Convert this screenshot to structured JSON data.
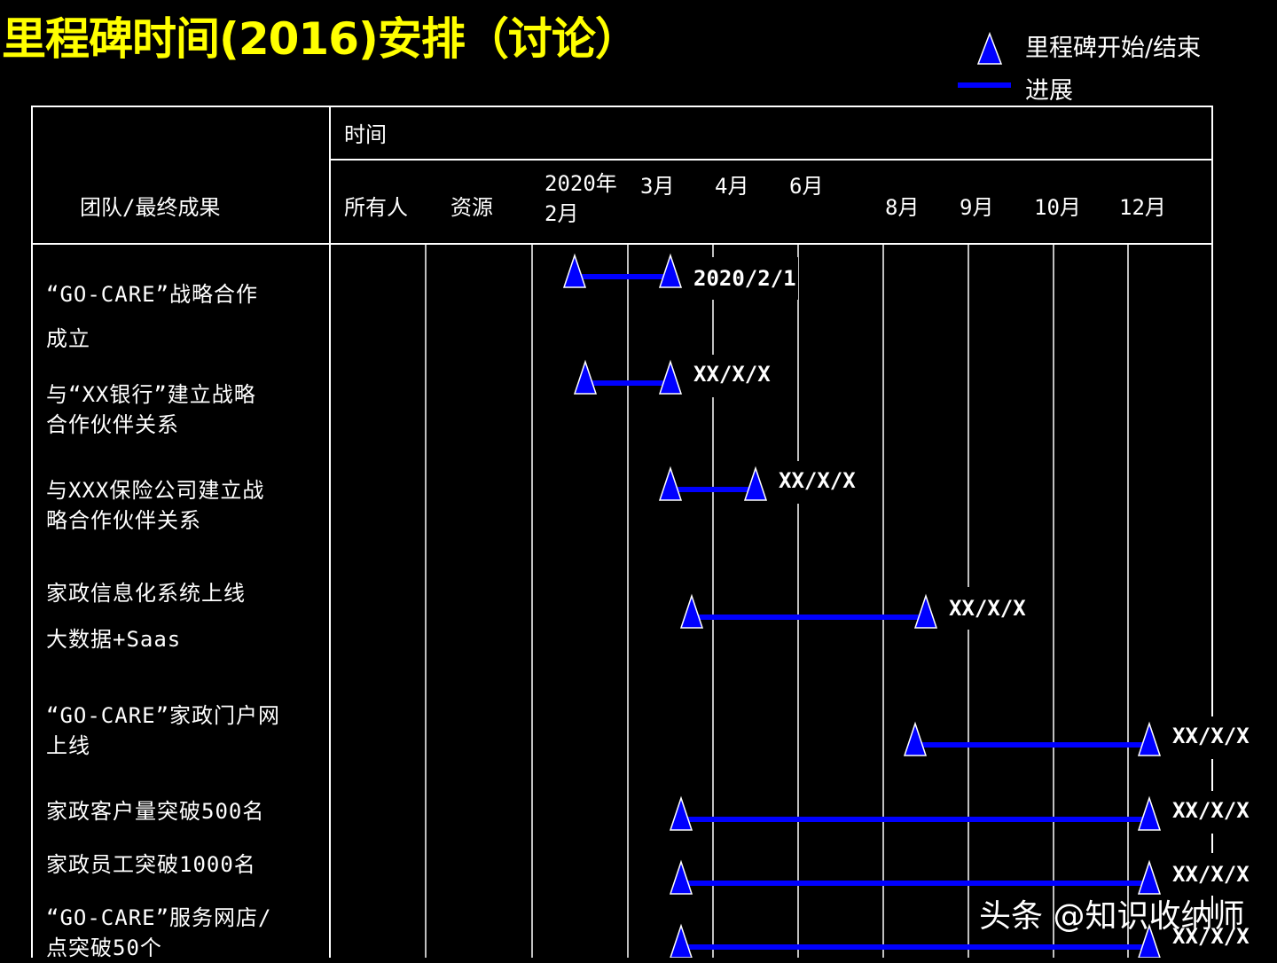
{
  "title": "里程碑时间(2016)安排（讨论）",
  "legend": {
    "milestone_label": "里程碑开始/结束",
    "progress_label": "进展"
  },
  "header": {
    "team_label": "团队/最终成果",
    "time_label": "时间",
    "owner_label": "所有人",
    "resource_label": "资源",
    "months": [
      "2020年\n2月",
      "3月",
      "4月",
      "6月",
      "8月",
      "9月",
      "10月",
      "12月"
    ]
  },
  "tasks": [
    {
      "label": "“GO-CARE”战略合作\n\n成立",
      "end_label": "2020/2/1"
    },
    {
      "label": "与“XX银行”建立战略\n合作伙伴关系",
      "end_label": "XX/X/X"
    },
    {
      "label": "与XXX保险公司建立战\n略合作伙伴关系",
      "end_label": "XX/X/X"
    },
    {
      "label": "家政信息化系统上线\n\n大数据+Saas",
      "end_label": "XX/X/X"
    },
    {
      "label": "“GO-CARE”家政门户网\n上线",
      "end_label": "XX/X/X"
    },
    {
      "label": "家政客户量突破500名",
      "end_label": "XX/X/X"
    },
    {
      "label": "家政员工突破1000名",
      "end_label": "XX/X/X"
    },
    {
      "label": "“GO-CARE”服务网店/\n点突破50个",
      "end_label": "XX/X/X"
    }
  ],
  "watermark": "头条 @知识收纳师",
  "colors": {
    "title": "#ffff00",
    "milestone": "#0000ff",
    "progress": "#0000ff",
    "grid": "#ffffff",
    "background": "#000000"
  }
}
